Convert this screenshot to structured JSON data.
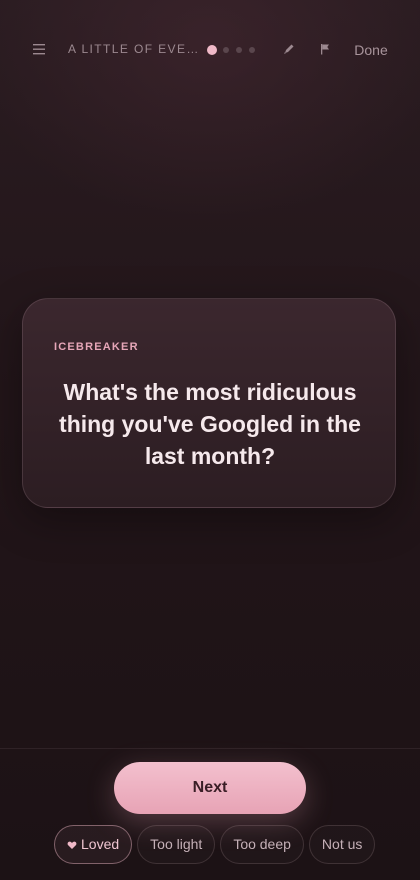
{
  "header": {
    "session_title": "A LITTLE OF EVERYTHING",
    "progress": {
      "current": 1,
      "total": 4
    },
    "done_label": "Done",
    "icons": {
      "menu": "hamburger-menu-icon",
      "edit": "pencil-icon",
      "flag": "flag-icon"
    }
  },
  "card": {
    "category": "ICEBREAKER",
    "question": "What's the most ridiculous thing you've Googled in the last month?"
  },
  "actions": {
    "next_label": "Next"
  },
  "reactions": [
    {
      "label": "Loved",
      "selected": true,
      "icon": "heart-icon"
    },
    {
      "label": "Too light",
      "selected": false
    },
    {
      "label": "Too deep",
      "selected": false
    },
    {
      "label": "Not us",
      "selected": false
    }
  ],
  "colors": {
    "accent": "#f0b9c8",
    "background": "#221519",
    "card": "#34232a"
  }
}
